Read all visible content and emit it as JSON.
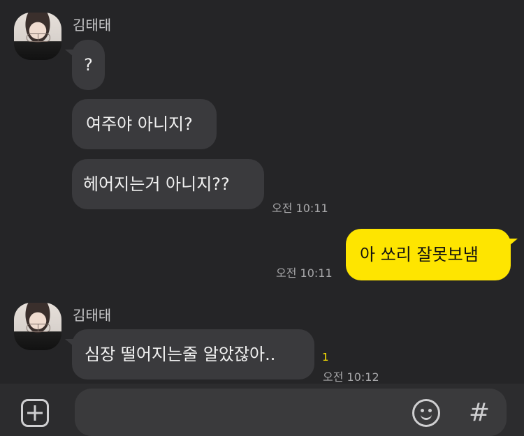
{
  "chat": {
    "groups": [
      {
        "sender": "김태태",
        "messages": [
          "?",
          "여주야 아니지?",
          "헤어지는거 아니지??"
        ],
        "time": "오전 10:11"
      },
      {
        "outgoing_message": "아 쏘리 잘못보냄",
        "time": "오전 10:11"
      },
      {
        "sender": "김태태",
        "messages": [
          "심장 떨어지는줄 알았잖아.."
        ],
        "unread_count": "1",
        "time": "오전 10:12"
      }
    ]
  },
  "bottom_bar": {
    "input_placeholder": "",
    "icons": [
      "plus-icon",
      "emoji-icon",
      "hash-icon"
    ]
  }
}
